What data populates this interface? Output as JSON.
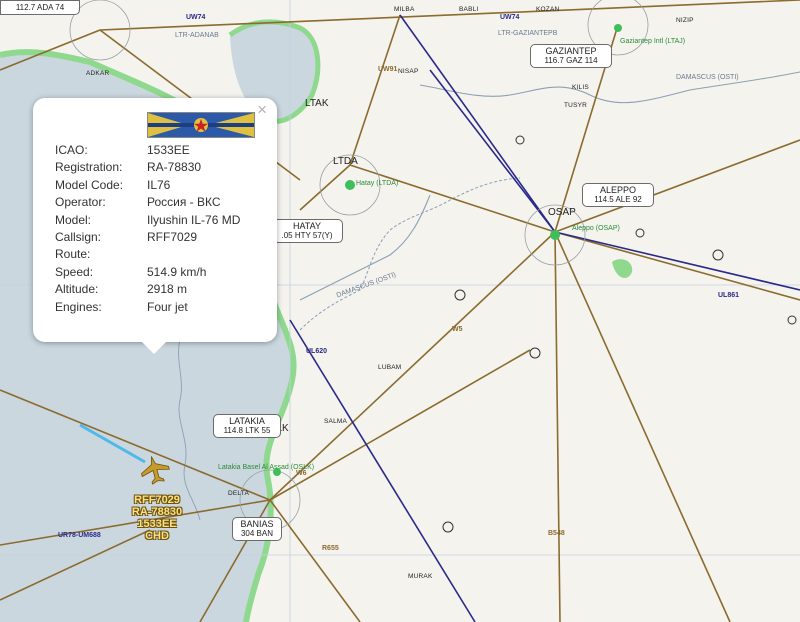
{
  "popup": {
    "close_symbol": "×",
    "flag_icon": "russian-aerospace-forces-flag-icon",
    "rows": [
      {
        "key": "ICAO:",
        "value": "1533EE"
      },
      {
        "key": "Registration:",
        "value": "RA-78830"
      },
      {
        "key": "Model Code:",
        "value": "IL76"
      },
      {
        "key": "Operator:",
        "value": "Россия - ВКС"
      },
      {
        "key": "Model:",
        "value": "Ilyushin IL-76 MD"
      },
      {
        "key": "Callsign:",
        "value": "RFF7029"
      },
      {
        "key": "Route:",
        "value": ""
      },
      {
        "key": "Speed:",
        "value": "514.9 km/h"
      },
      {
        "key": "Altitude:",
        "value": "2918 m"
      },
      {
        "key": "Engines:",
        "value": "Four jet"
      }
    ]
  },
  "aircraft": {
    "icon": "airplane-icon",
    "label_lines": [
      "RFF7029",
      "RA-78830",
      "1533EE",
      "CHD"
    ],
    "color": "#c89a2a"
  },
  "navaids": {
    "gaziantep": {
      "name": "GAZIANTEP",
      "freq": "116.7 GAZ 114"
    },
    "aleppo": {
      "name": "ALEPPO",
      "freq": "114.5 ALE 92"
    },
    "hatay": {
      "name": "HATAY",
      "freq": ".05 HTY 57(Y)"
    },
    "latakia": {
      "name": "LATAKIA",
      "freq": "114.8 LTK 55"
    },
    "banias": {
      "name": "BANIAS",
      "freq": "304 BAN"
    },
    "adana": {
      "name": "112.7 ADA 74"
    }
  },
  "airports": {
    "ltak": "LTAK",
    "ltda": "LTDA",
    "osap": "OSAP",
    "oslk": "OSLK",
    "hatay_sub": "Hatay (LTDA)",
    "aleppo_sub": "Aleppo (OSAP)",
    "gaziantep_sub": "Gaziantep Intl (LTAJ)",
    "latakia_sub": "Latakia Basel Al Assad (OSLK)"
  },
  "fixes": [
    "ADKAR",
    "NISAP",
    "KILIS",
    "TUSYR",
    "LUBAM",
    "SALMA",
    "DELTA",
    "MURAK",
    "MILBA",
    "BABLI",
    "KOZAN",
    "NIZIP"
  ],
  "borders": {
    "ltr_adanab": "LTR-ADANAB",
    "ltr_gaziantepb": "LTR-GAZIANTEPB",
    "damascus_osti_1": "DAMASCUS (OSTI)",
    "damascus_osti_2": "DAMASCUS (OSTI)"
  },
  "routes": {
    "uw74a": "UW74",
    "uw74b": "UW74",
    "uw91": "UW91",
    "ul861": "UL861",
    "ul620": "UL620",
    "w5": "W5",
    "w6": "W6",
    "b548": "B548",
    "r655": "R655",
    "ur78": "UR78-UM688"
  },
  "colors": {
    "sea": "#cad7df",
    "coast": "#8fd98f",
    "land": "#f4f3ee",
    "route_brown": "#8b6b2e",
    "route_blue": "#2b2a8a",
    "track": "#4fb9ea"
  }
}
